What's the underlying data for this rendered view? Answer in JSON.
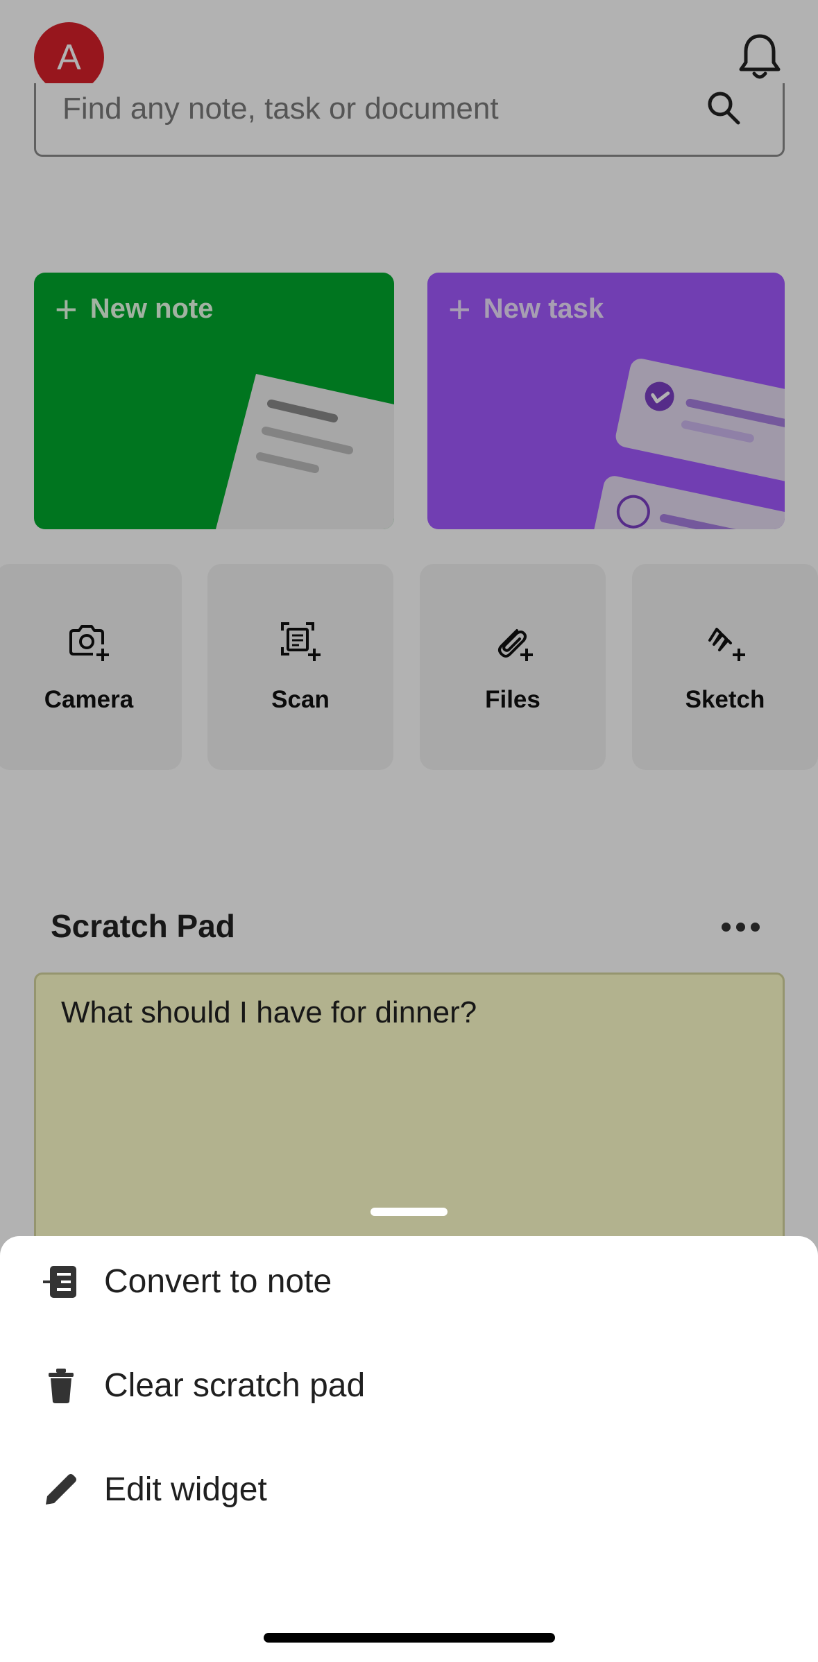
{
  "header": {
    "avatar_initial": "A",
    "avatar_color": "#d8202a",
    "notification_icon": "bell-icon"
  },
  "search": {
    "placeholder": "Find any note, task or document",
    "icon": "search-icon"
  },
  "quick_create": [
    {
      "label": "New note",
      "color": "#00a82d"
    },
    {
      "label": "New task",
      "color": "#a259ff"
    }
  ],
  "tiles": [
    {
      "label": "Camera",
      "icon": "camera-plus-icon"
    },
    {
      "label": "Scan",
      "icon": "scan-plus-icon"
    },
    {
      "label": "Files",
      "icon": "paperclip-plus-icon"
    },
    {
      "label": "Sketch",
      "icon": "sketch-plus-icon"
    }
  ],
  "scratch_pad": {
    "title": "Scratch Pad",
    "content": "What should I have for dinner?",
    "color": "#ffffcc"
  },
  "sheet": {
    "items": [
      {
        "label": "Convert to note",
        "icon": "convert-note-icon"
      },
      {
        "label": "Clear scratch pad",
        "icon": "trash-icon"
      },
      {
        "label": "Edit widget",
        "icon": "pencil-icon"
      }
    ]
  }
}
